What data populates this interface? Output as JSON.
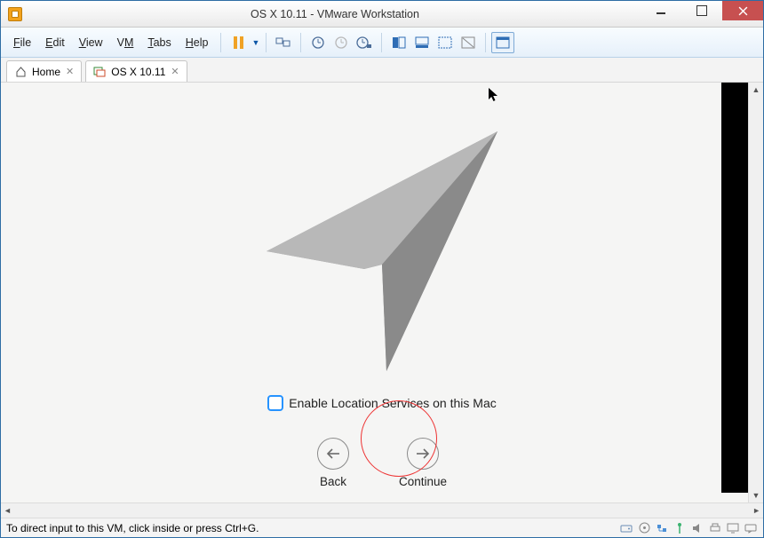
{
  "window": {
    "title": "OS X 10.11 - VMware Workstation"
  },
  "menu": {
    "file": "File",
    "edit": "Edit",
    "view": "View",
    "vm": "VM",
    "tabs": "Tabs",
    "help": "Help"
  },
  "tabs": {
    "home": "Home",
    "vm": "OS X 10.11"
  },
  "setup": {
    "checkbox_label": "Enable Location Services on this Mac",
    "back_label": "Back",
    "continue_label": "Continue"
  },
  "status": {
    "hint": "To direct input to this VM, click inside or press Ctrl+G."
  },
  "icons": {
    "pause": "pause-icon",
    "dropdown": "▼",
    "snapshot": "snapshot-icon"
  }
}
